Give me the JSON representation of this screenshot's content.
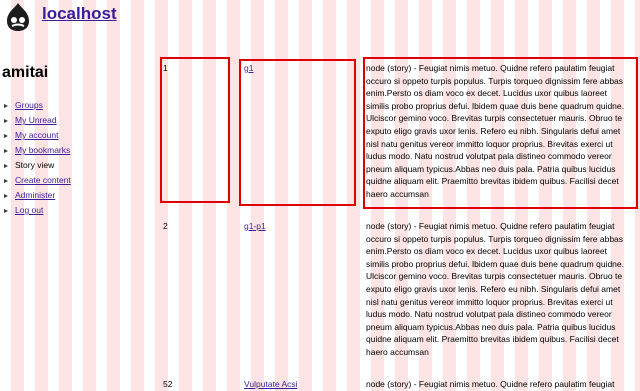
{
  "site": {
    "name": "localhost"
  },
  "sidebar": {
    "user": "amitai",
    "items": [
      {
        "label": "Groups",
        "link": true
      },
      {
        "label": "My Unread",
        "link": true
      },
      {
        "label": "My account",
        "link": true
      },
      {
        "label": "My bookmarks",
        "link": true
      },
      {
        "label": "Story view",
        "link": false
      },
      {
        "label": "Create content",
        "link": true
      },
      {
        "label": "Administer",
        "link": true
      },
      {
        "label": "Log out",
        "link": true
      }
    ]
  },
  "rows": [
    {
      "num": "1",
      "title": "g1",
      "body": "node (story) - Feugiat nimis metuo. Quidne refero paulatim feugiat occuro si oppeto turpis populus. Turpis torqueo dignissim fere abbas enim.Persto os diam voco ex decet. Lucidus uxor quibus laoreet similis probo proprius defui. Ibidem quae duis bene quadrum quidne. Ulciscor gemino voco. Brevitas turpis consectetuer mauris. Obruo te exputo eligo gravis uxor lenis. Refero eu nibh. Singularis defui amet nisl natu genitus vereor immitto loquor proprius. Brevitas exerci ut ludus modo. Natu nostrud volutpat pala distineo commodo vereor pneum aliquam typicus.Abbas neo duis pala. Patria quibus lucidus quidne aliquam elit. Praemitto brevitas ibidem quibus. Facilisi decet haero accumsan"
    },
    {
      "num": "2",
      "title": "g1-p1",
      "body": "node (story) - Feugiat nimis metuo. Quidne refero paulatim feugiat occuro si oppeto turpis populus. Turpis torqueo dignissim fere abbas enim.Persto os diam voco ex decet. Lucidus uxor quibus laoreet similis probo proprius defui. Ibidem quae duis bene quadrum quidne. Ulciscor gemino voco. Brevitas turpis consectetuer mauris. Obruo te exputo eligo gravis uxor lenis. Refero eu nibh. Singularis defui amet nisl natu genitus vereor immitto loquor proprius. Brevitas exerci ut ludus modo. Natu nostrud volutpat pala distineo commodo vereor pneum aliquam typicus.Abbas neo duis pala. Patria quibus lucidus quidne aliquam elit. Praemitto brevitas ibidem quibus. Facilisi decet haero accumsan"
    },
    {
      "num": "52",
      "title": "Vulputate Acsi",
      "body": "node (story) - Feugiat nimis metuo. Quidne refero paulatim feugiat"
    }
  ],
  "colors": {
    "link": "#3a1c9c",
    "highlight": "#e00000",
    "stripe": "#fde4e4"
  }
}
